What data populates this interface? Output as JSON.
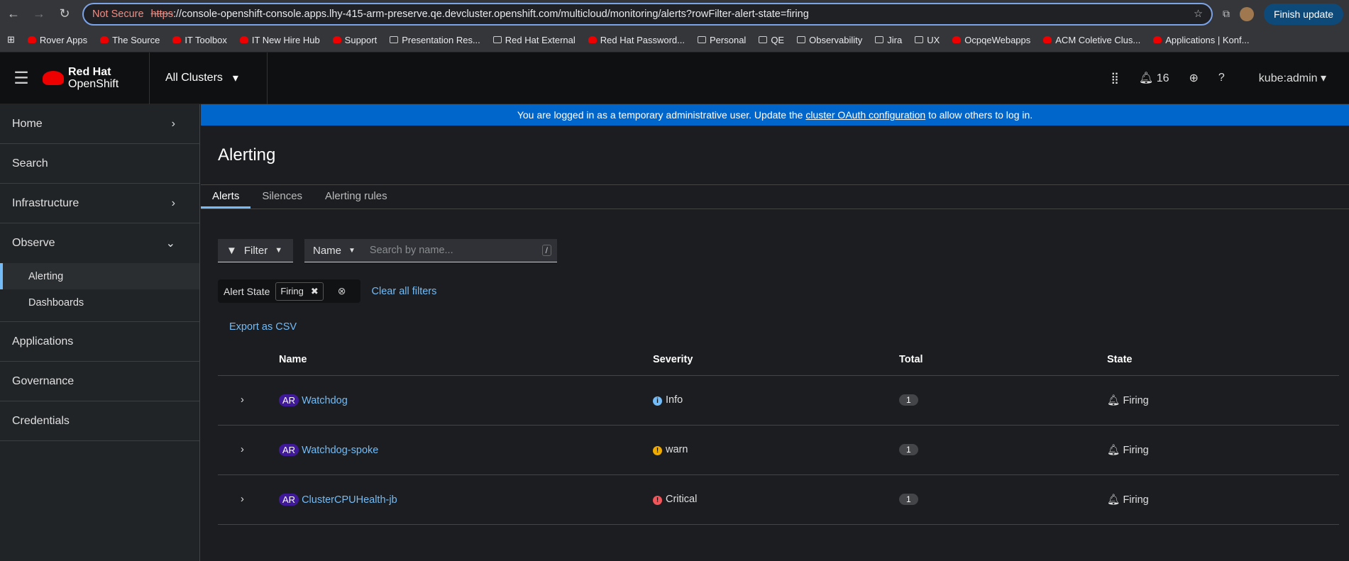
{
  "browser": {
    "not_secure": "Not Secure",
    "scheme": "https",
    "url_rest": "://console-openshift-console.apps.lhy-415-arm-preserve.qe.devcluster.openshift.com/multicloud/monitoring/alerts?rowFilter-alert-state=firing",
    "finish_update": "Finish update",
    "bookmarks": [
      {
        "label": "Rover Apps",
        "icon": "redhat"
      },
      {
        "label": "The Source",
        "icon": "redhat"
      },
      {
        "label": "IT Toolbox",
        "icon": "redhat"
      },
      {
        "label": "IT New Hire Hub",
        "icon": "redhat"
      },
      {
        "label": "Support",
        "icon": "redhat"
      },
      {
        "label": "Presentation Res...",
        "icon": "folder"
      },
      {
        "label": "Red Hat External",
        "icon": "folder"
      },
      {
        "label": "Red Hat Password...",
        "icon": "redhat"
      },
      {
        "label": "Personal",
        "icon": "folder"
      },
      {
        "label": "QE",
        "icon": "folder"
      },
      {
        "label": "Observability",
        "icon": "folder"
      },
      {
        "label": "Jira",
        "icon": "folder"
      },
      {
        "label": "UX",
        "icon": "folder"
      },
      {
        "label": "OcpqeWebapps",
        "icon": "globe"
      },
      {
        "label": "ACM Coletive Clus...",
        "icon": "app"
      },
      {
        "label": "Applications | Konf...",
        "icon": "redhat"
      }
    ]
  },
  "masthead": {
    "brand1": "Red Hat",
    "brand2": "OpenShift",
    "cluster": "All Clusters",
    "notifications": "16",
    "user": "kube:admin"
  },
  "sidebar": {
    "items": [
      {
        "label": "Home",
        "chevron": "›"
      },
      {
        "label": "Search"
      },
      {
        "label": "Infrastructure",
        "chevron": "›"
      },
      {
        "label": "Observe",
        "chevron": "⌄"
      },
      {
        "label": "Applications"
      },
      {
        "label": "Governance"
      },
      {
        "label": "Credentials"
      }
    ],
    "observe_sub": [
      "Alerting",
      "Dashboards"
    ]
  },
  "banner": {
    "pre": "You are logged in as a temporary administrative user. Update the ",
    "link": "cluster OAuth configuration",
    "post": " to allow others to log in."
  },
  "page": {
    "title": "Alerting",
    "tabs": [
      "Alerts",
      "Silences",
      "Alerting rules"
    ],
    "filter": "Filter",
    "name_select": "Name",
    "search_placeholder": "Search by name...",
    "kbd": "/",
    "chip_group": "Alert State",
    "chip": "Firing",
    "clear_all": "Clear all filters",
    "export": "Export as CSV",
    "columns": [
      "Name",
      "Severity",
      "Total",
      "State"
    ],
    "rows": [
      {
        "badge": "AR",
        "name": "Watchdog",
        "severity": "Info",
        "sev_color": "#73bcf7",
        "sev_glyph": "i",
        "total": "1",
        "state": "Firing"
      },
      {
        "badge": "AR",
        "name": "Watchdog-spoke",
        "severity": "warn",
        "sev_color": "#f0ab00",
        "sev_glyph": "!",
        "total": "1",
        "state": "Firing"
      },
      {
        "badge": "AR",
        "name": "ClusterCPUHealth-jb",
        "severity": "Critical",
        "sev_color": "#f0565a",
        "sev_glyph": "!",
        "total": "1",
        "state": "Firing"
      }
    ]
  }
}
